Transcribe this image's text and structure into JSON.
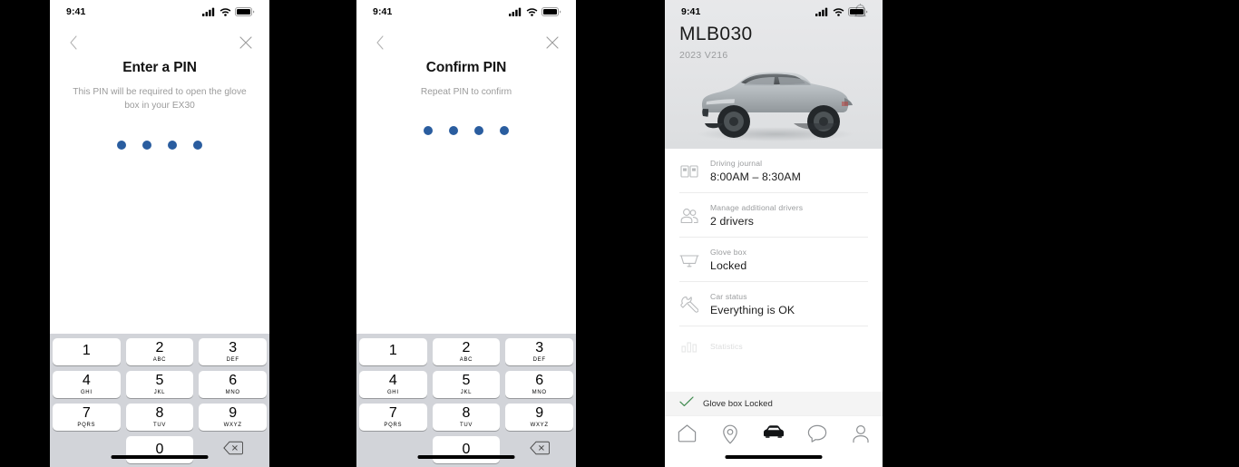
{
  "statusbar": {
    "time": "9:41",
    "signal_icon": "cellular-signal-icon",
    "wifi_icon": "wifi-icon",
    "battery_icon": "battery-icon"
  },
  "screens": {
    "enter_pin": {
      "title": "Enter a PIN",
      "subtitle": "This PIN will be required to open the glove box in your EX30",
      "back_icon": "chevron-left-icon",
      "close_icon": "close-icon",
      "dot_count": 4,
      "dot_color": "#2a5d9f"
    },
    "confirm_pin": {
      "title": "Confirm PIN",
      "subtitle": "Repeat PIN to confirm",
      "back_icon": "chevron-left-icon",
      "close_icon": "close-icon",
      "dot_count": 4,
      "dot_color": "#2a5d9f"
    }
  },
  "keypad": {
    "keys": [
      {
        "num": "1",
        "letters": ""
      },
      {
        "num": "2",
        "letters": "ABC"
      },
      {
        "num": "3",
        "letters": "DEF"
      },
      {
        "num": "4",
        "letters": "GHI"
      },
      {
        "num": "5",
        "letters": "JKL"
      },
      {
        "num": "6",
        "letters": "MNO"
      },
      {
        "num": "7",
        "letters": "PQRS"
      },
      {
        "num": "8",
        "letters": "TUV"
      },
      {
        "num": "9",
        "letters": "WXYZ"
      },
      {
        "num": "0",
        "letters": ""
      }
    ],
    "delete_icon": "backspace-delete-icon"
  },
  "car_screen": {
    "bell_icon": "notification-bell-icon",
    "car_name": "MLB030",
    "car_model": "2023 V216",
    "car_image": "volvo-ex30-silver-suv",
    "rows": [
      {
        "icon": "driving-journal-book-icon",
        "label": "Driving journal",
        "value": "8:00AM – 8:30AM"
      },
      {
        "icon": "additional-drivers-people-icon",
        "label": "Manage additional drivers",
        "value": "2 drivers"
      },
      {
        "icon": "glove-box-icon",
        "label": "Glove box",
        "value": "Locked"
      },
      {
        "icon": "car-status-wrench-icon",
        "label": "Car status",
        "value": "Everything is OK"
      },
      {
        "icon": "statistics-icon",
        "label": "Statistics",
        "value": ""
      }
    ],
    "toast": {
      "icon": "check-icon",
      "icon_color": "#3f8a4f",
      "text": "Glove box Locked"
    },
    "tabs": [
      {
        "icon": "home-icon",
        "active": false
      },
      {
        "icon": "location-pin-icon",
        "active": false
      },
      {
        "icon": "car-icon",
        "active": true
      },
      {
        "icon": "chat-bubble-icon",
        "active": false
      },
      {
        "icon": "profile-person-icon",
        "active": false
      }
    ]
  }
}
